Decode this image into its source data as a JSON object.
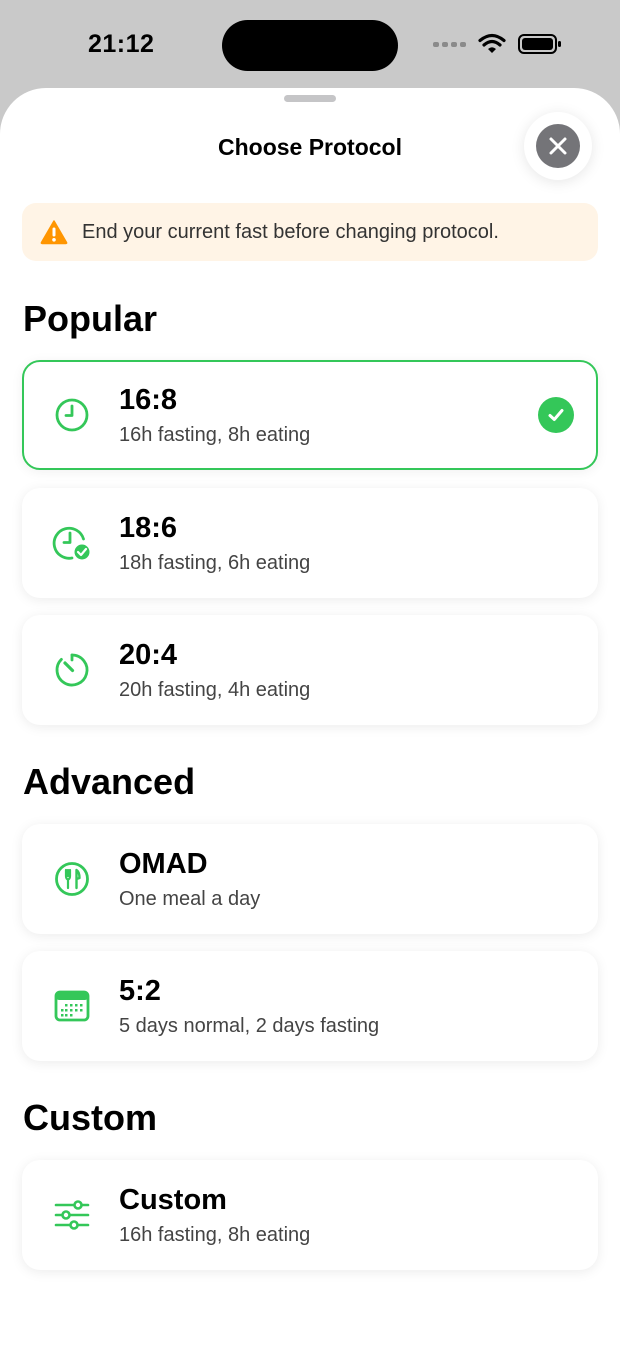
{
  "status_bar": {
    "time": "21:12"
  },
  "sheet": {
    "title": "Choose Protocol",
    "warning": "End your current fast before changing protocol."
  },
  "sections": {
    "popular": {
      "title": "Popular",
      "items": [
        {
          "title": "16:8",
          "subtitle": "16h fasting, 8h eating",
          "icon": "clock-icon",
          "selected": true
        },
        {
          "title": "18:6",
          "subtitle": "18h fasting, 6h eating",
          "icon": "clock-check-icon",
          "selected": false
        },
        {
          "title": "20:4",
          "subtitle": "20h fasting, 4h eating",
          "icon": "timer-icon",
          "selected": false
        }
      ]
    },
    "advanced": {
      "title": "Advanced",
      "items": [
        {
          "title": "OMAD",
          "subtitle": "One meal a day",
          "icon": "fork-knife-icon",
          "selected": false
        },
        {
          "title": "5:2",
          "subtitle": "5 days normal, 2 days fasting",
          "icon": "calendar-icon",
          "selected": false
        }
      ]
    },
    "custom": {
      "title": "Custom",
      "items": [
        {
          "title": "Custom",
          "subtitle": "16h fasting, 8h eating",
          "icon": "sliders-icon",
          "selected": false
        }
      ]
    }
  },
  "colors": {
    "accent": "#34c759",
    "warning": "#ff9500",
    "warning_bg": "#fff4e6"
  }
}
